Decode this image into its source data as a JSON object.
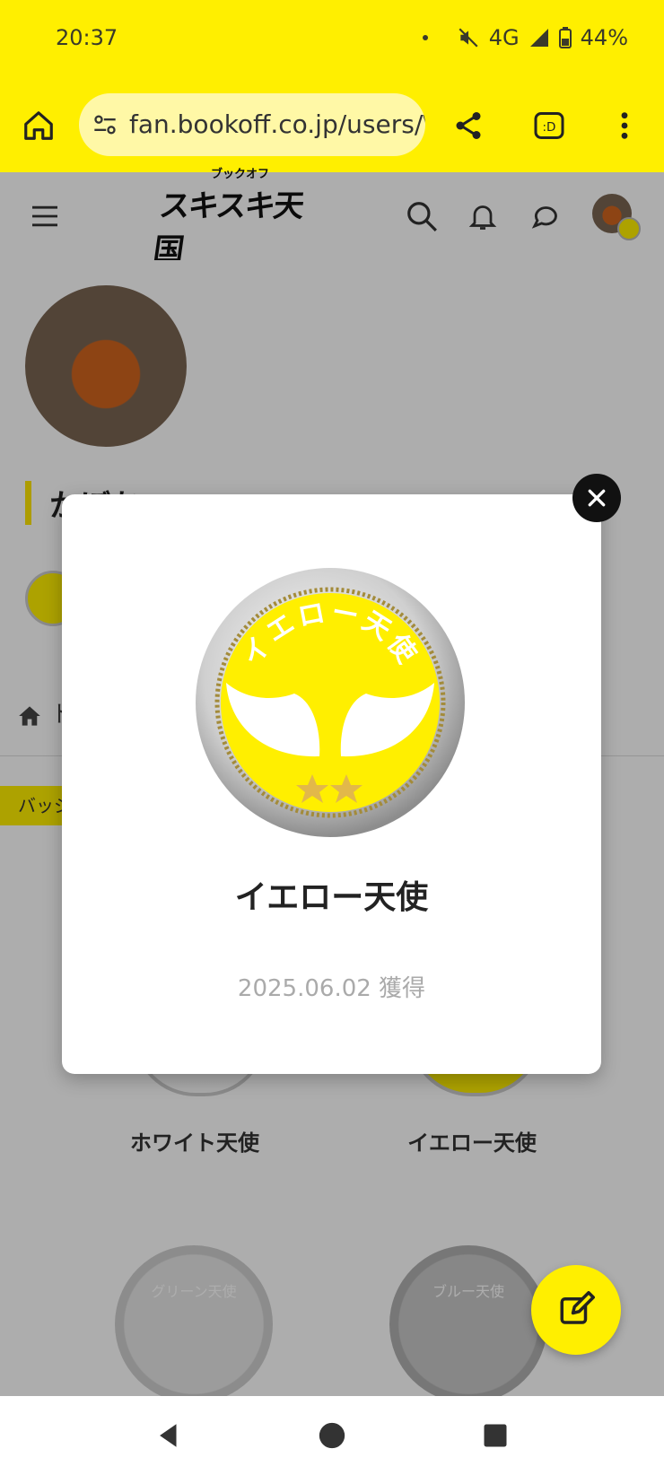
{
  "status": {
    "time": "20:37",
    "network": "4G",
    "battery": "44%"
  },
  "browser": {
    "url": "fan.bookoff.co.jp/users/\\"
  },
  "site": {
    "logo_small": "ブックオフ",
    "logo_main": "スキスキ天国"
  },
  "profile": {
    "name_partial": "かぼち",
    "breadcrumb_partial": "ト",
    "tab_partial": "バッジ"
  },
  "badges": [
    {
      "label": "ホワイト天使"
    },
    {
      "label": "イエロー天使"
    },
    {
      "label": "",
      "medal_text": "グリーン天使"
    },
    {
      "label": "",
      "medal_text": "ブルー天使"
    }
  ],
  "modal": {
    "medal_text": "イエロー天使",
    "title": "イエロー天使",
    "date": "2025.06.02 獲得"
  },
  "colors": {
    "brand_yellow": "#ffef00",
    "overlay": "rgba(0,0,0,0.32)"
  }
}
